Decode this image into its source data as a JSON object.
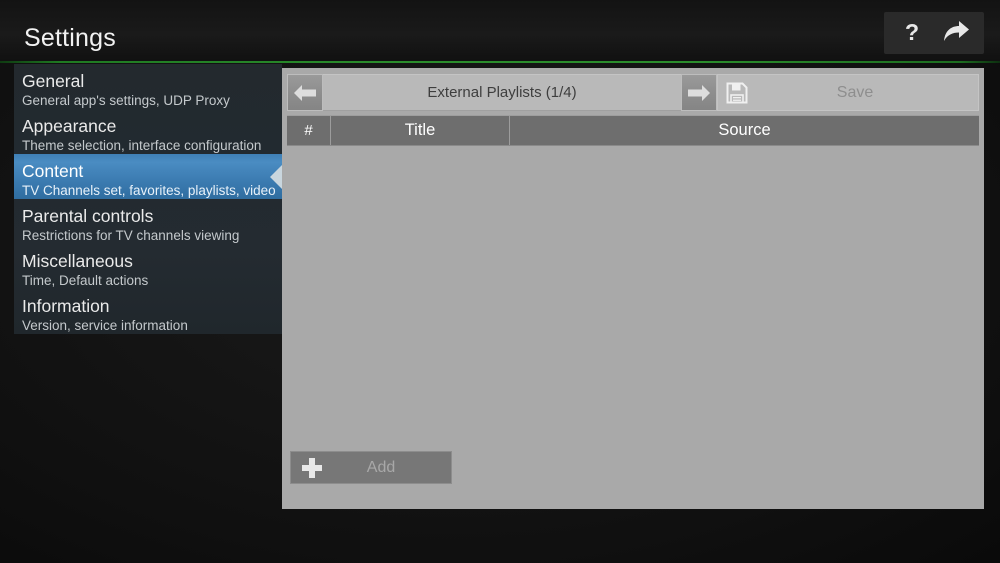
{
  "titlebar": {
    "title": "Settings",
    "buttons": [
      {
        "name": "help-button",
        "icon": "question-mark-icon",
        "label": "?"
      },
      {
        "name": "exit-button",
        "icon": "forward-arrow-icon",
        "label": ""
      }
    ]
  },
  "sidebar": {
    "items": [
      {
        "title": "General",
        "subtitle": "General app's settings, UDP Proxy",
        "selected": false
      },
      {
        "title": "Appearance",
        "subtitle": "Theme selection, interface configuration",
        "selected": false
      },
      {
        "title": "Content",
        "subtitle": "TV Channels set, favorites, playlists, video",
        "selected": true
      },
      {
        "title": "Parental controls",
        "subtitle": "Restrictions for TV channels viewing",
        "selected": false
      },
      {
        "title": "Miscellaneous",
        "subtitle": "Time, Default actions",
        "selected": false
      },
      {
        "title": "Information",
        "subtitle": "Version, service information",
        "selected": false
      }
    ]
  },
  "main": {
    "header": {
      "prev_icon": "left-arrow-icon",
      "title": "External Playlists (1/4)",
      "next_icon": "right-arrow-icon",
      "save_icon": "floppy-disk-icon",
      "save_label": "Save"
    },
    "table": {
      "columns": [
        "#",
        "Title",
        "Source"
      ],
      "rows": []
    },
    "add_button": {
      "icon": "plus-icon",
      "label": "Add"
    }
  },
  "colors": {
    "accent_green": "#2b8c2c",
    "selection_blue": "#3f7fb5",
    "panel_gray": "#a9a9a9",
    "table_header_gray": "#6e6e6e"
  }
}
